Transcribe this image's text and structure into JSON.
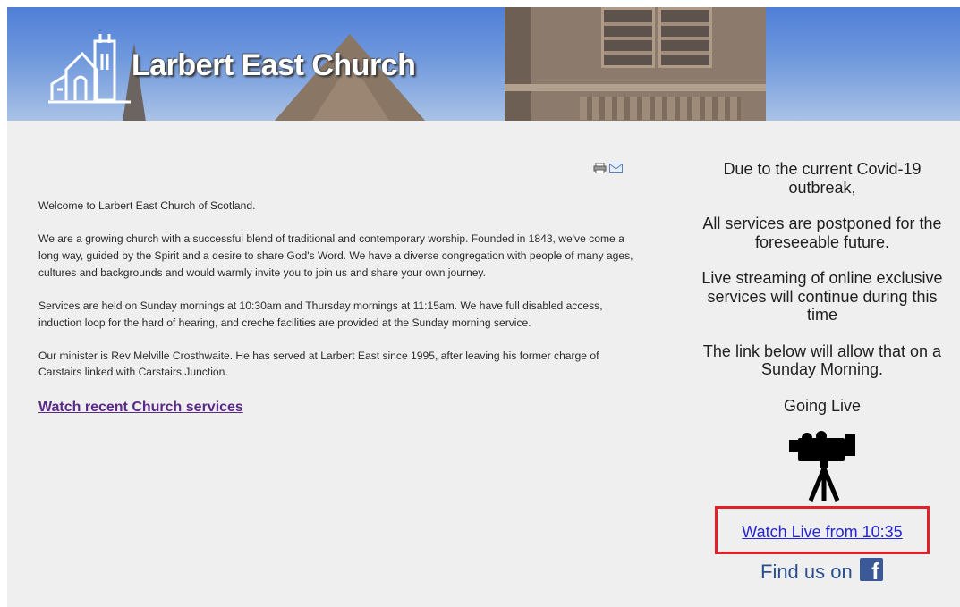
{
  "header": {
    "title": "Larbert East Church",
    "logo_icon": "church-logo-icon"
  },
  "toolbar": {
    "print_icon": "print-icon",
    "email_icon": "email-icon"
  },
  "main": {
    "paragraphs": [
      "Welcome to Larbert East Church of Scotland.",
      "We are a growing church with a successful blend of traditional and contemporary worship. Founded in 1843, we've come a long way, guided by the Spirit and a desire to share God's Word. We have a diverse congregation with people of many ages, cultures and backgrounds and would warmly invite you to join us and share your own journey.",
      "Services are held on Sunday mornings at 10:30am and Thursday mornings at 11:15am. We have full disabled access, induction loop for the hard of hearing, and creche facilities are provided at the Sunday morning service.",
      "Our minister is Rev Melville Crosthwaite. He has served at Larbert East since 1995, after leaving his former charge of Carstairs linked with Carstairs Junction."
    ],
    "watch_link": "Watch recent Church services"
  },
  "sidebar": {
    "notices": [
      "Due to the current Covid-19 outbreak,",
      "All services are postponed for the foreseeable future.",
      "Live streaming of online exclusive services will continue during this time",
      "The link below will allow that on a Sunday Morning.",
      "Going Live"
    ],
    "camera_icon": "video-camera-icon",
    "live_link": "Watch Live from 10:35",
    "find_us": "Find us on",
    "facebook_icon": "facebook-icon",
    "highlight_color": "#e3202a"
  },
  "colors": {
    "content_bg": "#efefef",
    "visited_link": "#5a2a86",
    "link": "#2525d6",
    "facebook": "#3b5998"
  }
}
